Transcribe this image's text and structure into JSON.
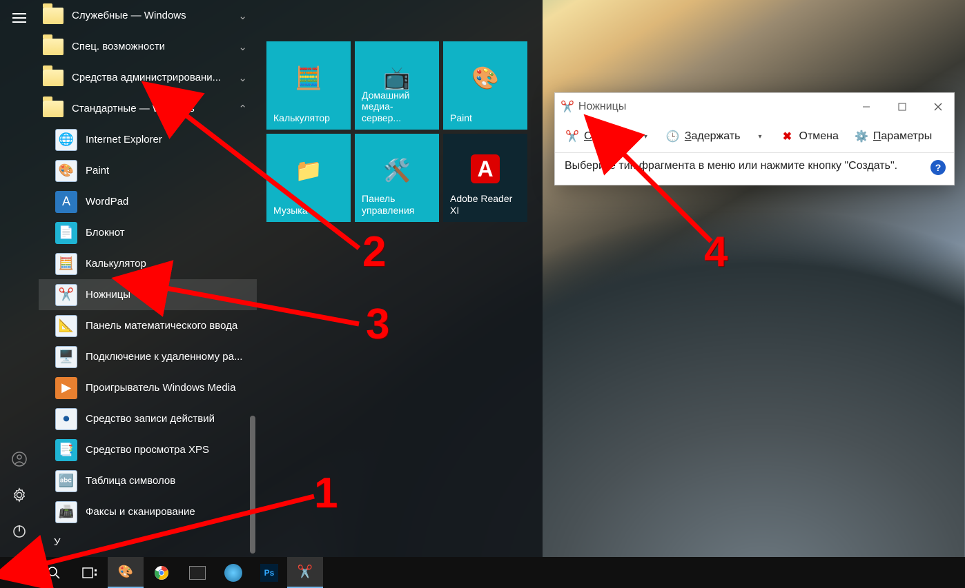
{
  "start_menu": {
    "folders": [
      {
        "label": "Служебные — Windows",
        "expanded": false
      },
      {
        "label": "Спец. возможности",
        "expanded": false
      },
      {
        "label": "Средства администрировани...",
        "expanded": false
      },
      {
        "label": "Стандартные — Windows",
        "expanded": true
      }
    ],
    "apps": [
      {
        "label": "Internet Explorer",
        "icon": "ie"
      },
      {
        "label": "Paint",
        "icon": "paint"
      },
      {
        "label": "WordPad",
        "icon": "wordpad"
      },
      {
        "label": "Блокнот",
        "icon": "notepad"
      },
      {
        "label": "Калькулятор",
        "icon": "calc"
      },
      {
        "label": "Ножницы",
        "icon": "snip",
        "selected": true
      },
      {
        "label": "Панель математического ввода",
        "icon": "math"
      },
      {
        "label": "Подключение к удаленному ра...",
        "icon": "rdp"
      },
      {
        "label": "Проигрыватель Windows Media",
        "icon": "wmp"
      },
      {
        "label": "Средство записи действий",
        "icon": "steps"
      },
      {
        "label": "Средство просмотра XPS",
        "icon": "xps"
      },
      {
        "label": "Таблица символов",
        "icon": "charmap"
      },
      {
        "label": "Факсы и сканирование",
        "icon": "fax"
      }
    ],
    "letter_header": "У",
    "tiles": [
      {
        "label": "Калькулятор",
        "style": "teal"
      },
      {
        "label": "Домашний медиа-сервер...",
        "style": "teal"
      },
      {
        "label": "Paint",
        "style": "teal"
      },
      {
        "label": "Музыка",
        "style": "teal"
      },
      {
        "label": "Панель управления",
        "style": "teal"
      },
      {
        "label": "Adobe Reader XI",
        "style": "dark"
      }
    ]
  },
  "snip": {
    "title": "Ножницы",
    "buttons": {
      "create": "Создать",
      "delay": "Задержать",
      "cancel": "Отмена",
      "options": "Параметры"
    },
    "info": "Выберите тип фрагмента в меню или нажмите кнопку \"Создать\"."
  },
  "taskbar": {
    "pinned": [
      "paint",
      "chrome",
      "cmd",
      "app",
      "photoshop",
      "snip"
    ]
  },
  "annotations": {
    "n1": "1",
    "n2": "2",
    "n3": "3",
    "n4": "4"
  }
}
